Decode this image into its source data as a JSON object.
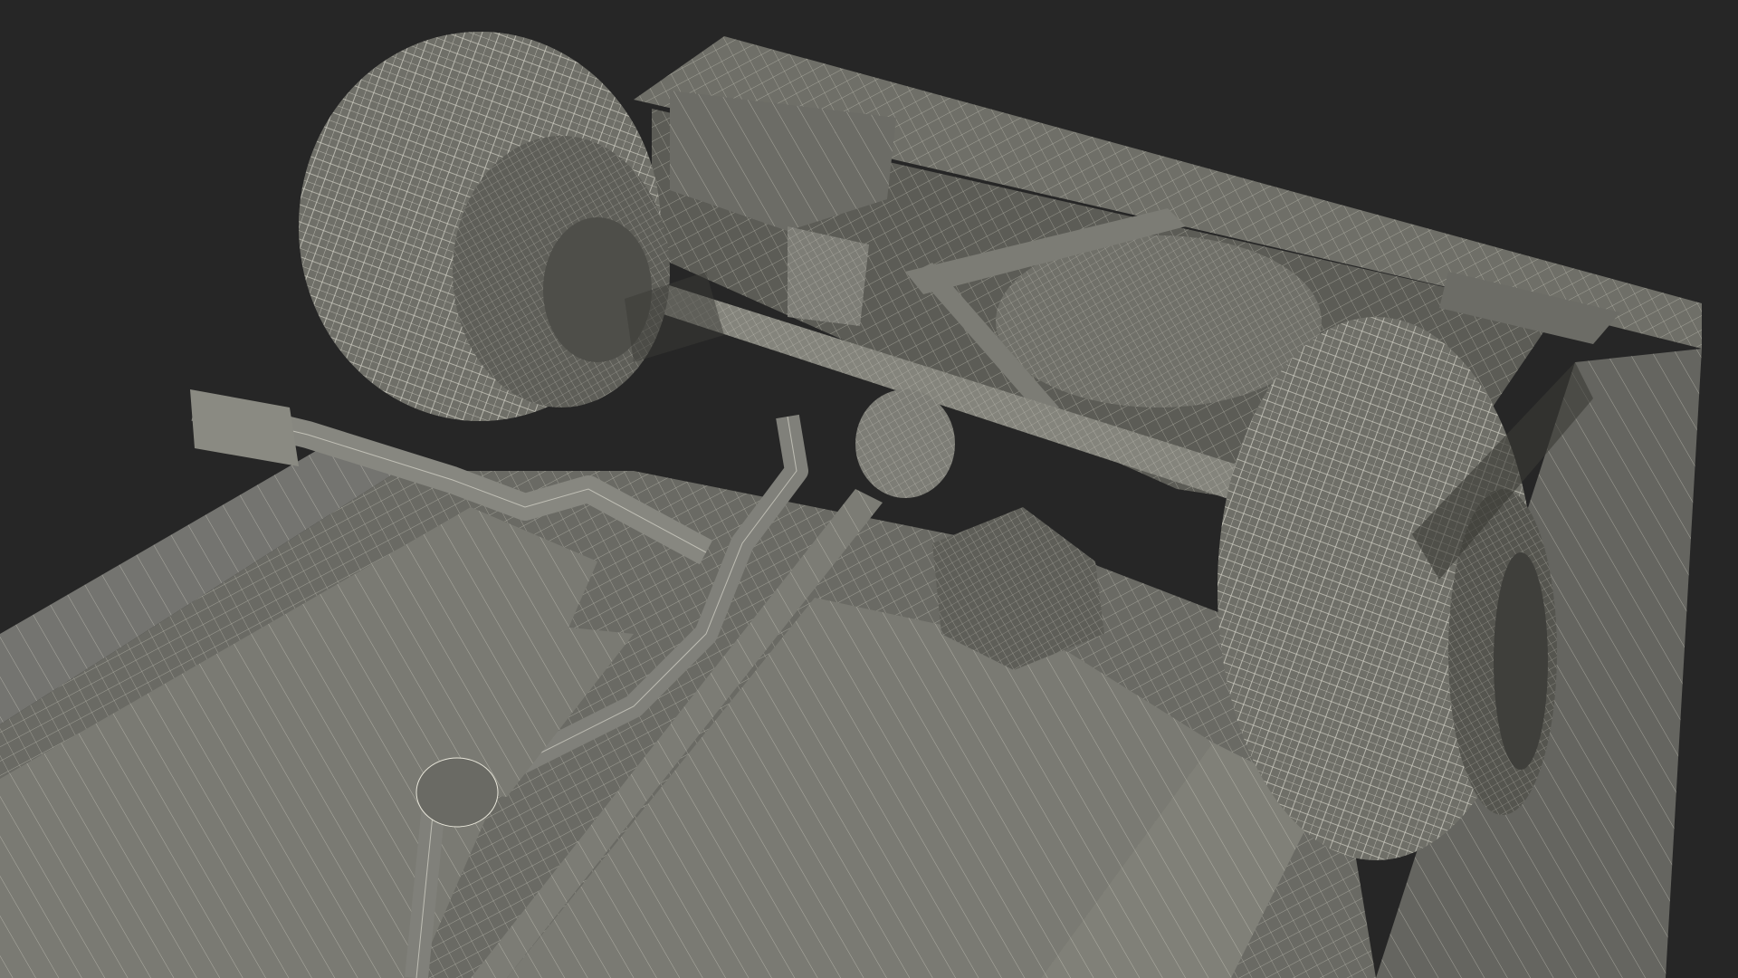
{
  "scene": {
    "subject": "car-underside-wireframe-render",
    "background_color": "#262626",
    "body_fill": "#6f6f68",
    "body_fill_dark": "#55554f",
    "body_fill_light": "#85857d",
    "wire_color": "#e8e6da",
    "shadow_color": "#3a3a36"
  }
}
